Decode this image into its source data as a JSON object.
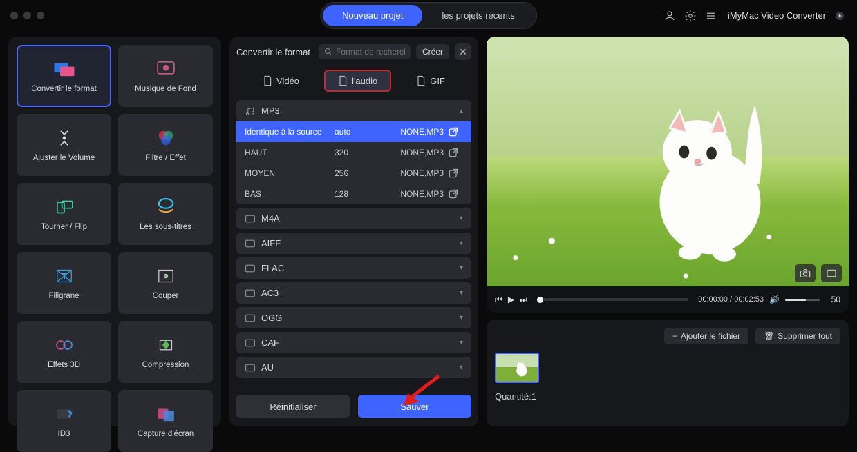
{
  "titlebar": {
    "tab_new": "Nouveau projet",
    "tab_recent": "les projets récents",
    "brand": "iMyMac Video Converter"
  },
  "tools": [
    {
      "id": "convert",
      "label": "Convertir le format",
      "active": true
    },
    {
      "id": "bgmusic",
      "label": "Musique de Fond"
    },
    {
      "id": "volume",
      "label": "Ajuster le Volume"
    },
    {
      "id": "filter",
      "label": "Filtre / Effet"
    },
    {
      "id": "rotate",
      "label": "Tourner / Flip"
    },
    {
      "id": "subtitles",
      "label": "Les sous-titres"
    },
    {
      "id": "watermark",
      "label": "Filigrane"
    },
    {
      "id": "crop",
      "label": "Couper"
    },
    {
      "id": "3d",
      "label": "Effets 3D"
    },
    {
      "id": "compress",
      "label": "Compression"
    },
    {
      "id": "id3",
      "label": "ID3"
    },
    {
      "id": "screenshot",
      "label": "Capture d'écran"
    }
  ],
  "mid": {
    "title": "Convertir le format",
    "search_placeholder": "Format de recherche",
    "create_label": "Créer",
    "type_tabs": {
      "video": "Vidéo",
      "audio": "l'audio",
      "gif": "GIF",
      "selected": "audio"
    },
    "expanded": "MP3",
    "formats": [
      "MP3",
      "M4A",
      "AIFF",
      "FLAC",
      "AC3",
      "OGG",
      "CAF",
      "AU"
    ],
    "presets": [
      {
        "name": "Identique à la source",
        "bitrate": "auto",
        "spec": "NONE,MP3",
        "selected": true
      },
      {
        "name": "HAUT",
        "bitrate": "320",
        "spec": "NONE,MP3"
      },
      {
        "name": "MOYEN",
        "bitrate": "256",
        "spec": "NONE,MP3"
      },
      {
        "name": "BAS",
        "bitrate": "128",
        "spec": "NONE,MP3"
      }
    ],
    "reset": "Réinitialiser",
    "save": "Sauver"
  },
  "player": {
    "current": "00:00:00",
    "total": "00:02:53",
    "volume_value": "50"
  },
  "queue": {
    "add": "Ajouter le fichier",
    "remove_all": "Supprimer tout",
    "qty_label": "Quantité:",
    "qty_value": "1"
  }
}
